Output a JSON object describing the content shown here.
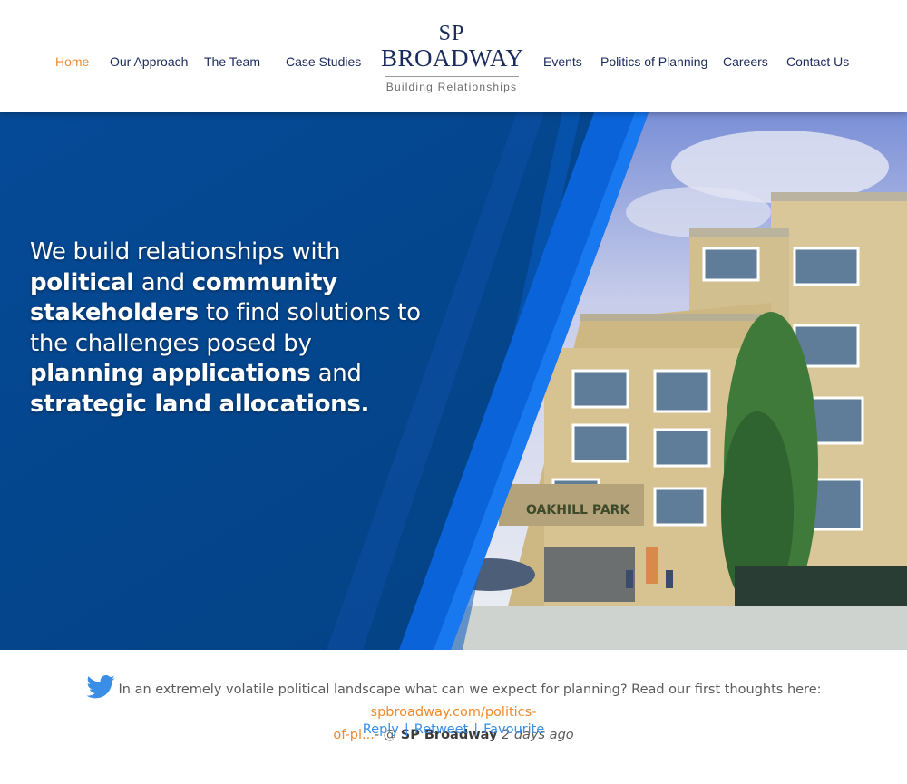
{
  "nav": {
    "home": "Home",
    "our_approach": "Our Approach",
    "the_team": "The Team",
    "case_studies": "Case Studies",
    "events": "Events",
    "politics_of_planning": "Politics of Planning",
    "careers": "Careers",
    "contact_us": "Contact Us"
  },
  "logo": {
    "line1": "SP",
    "line2": "BROADWAY",
    "tagline": "Building Relationships"
  },
  "hero": {
    "t1": "We build relationships with",
    "b1": "political",
    "t2": " and ",
    "b2": "community",
    "b3": "stakeholders",
    "t3": " to find solutions to",
    "t4": "the challenges posed by",
    "b4": "planning applications",
    "t5": " and",
    "b5": "strategic land allocations.",
    "image_sign": "OAKHILL PARK"
  },
  "tweet": {
    "text": "In an extremely volatile political landscape what can we expect for planning? Read our first thoughts here: ",
    "link1": "spbroadway.com/politics-",
    "link2": "of-pl...",
    "dash": "- @ ",
    "author": "SP Broadway",
    "when": "2 days ago",
    "reply": "Reply",
    "retweet": "Retweet",
    "favourite": "Favourite",
    "separator": "|"
  },
  "colors": {
    "navy": "#1b2a5c",
    "accent_orange": "#f08a2c",
    "hero_blue": "#04448f",
    "stripe_blue": "#0a63d8",
    "link_blue": "#3a8ee6"
  }
}
